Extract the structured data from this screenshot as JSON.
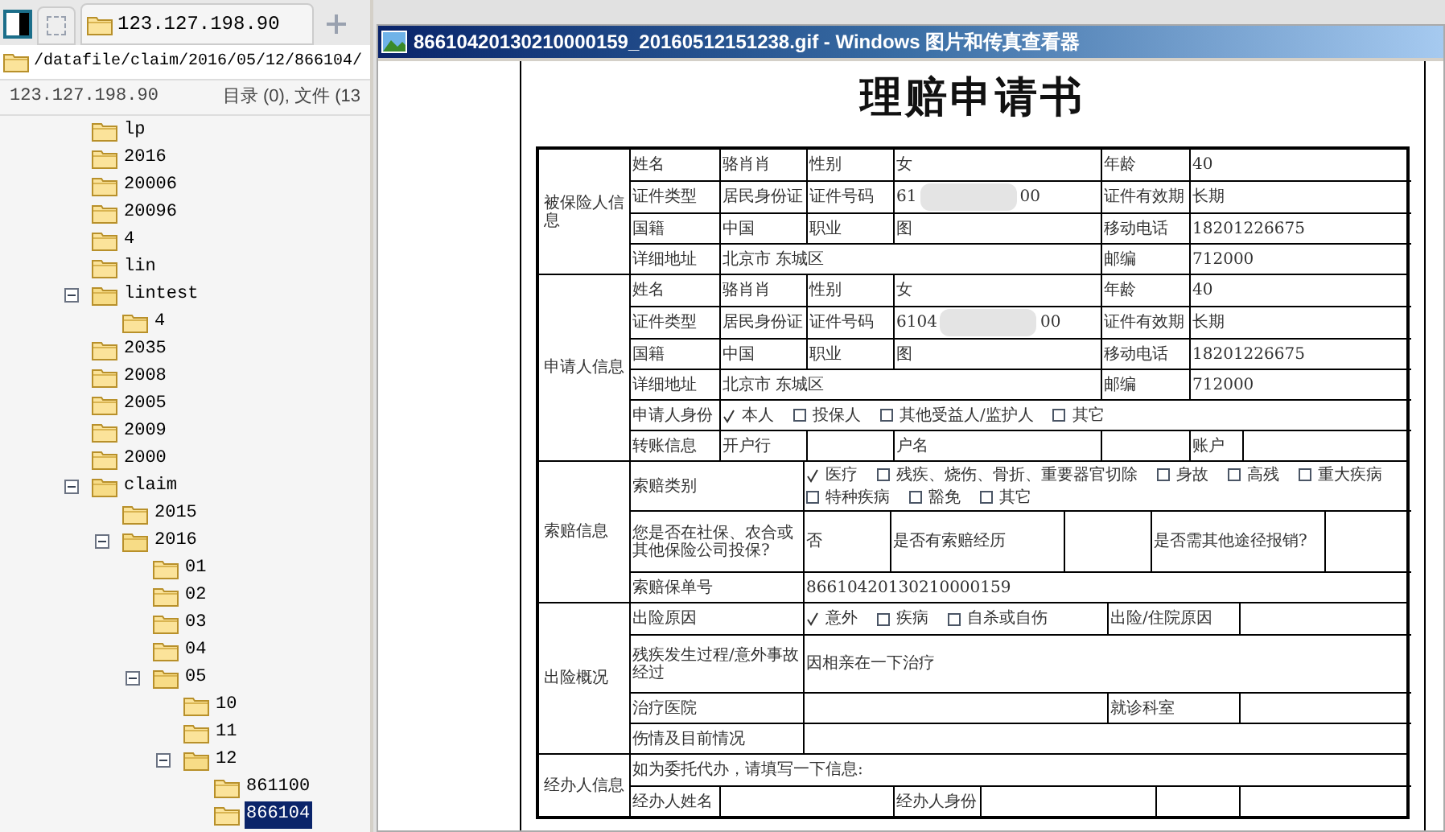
{
  "tabs": [
    {
      "label": "123.127.198.90",
      "selected": true
    }
  ],
  "path": "/datafile/claim/2016/05/12/866104/",
  "status": {
    "host": "123.127.198.90",
    "counts": "目录 (0), 文件 (13"
  },
  "tree": [
    {
      "label": "lp"
    },
    {
      "label": "2016"
    },
    {
      "label": "20006"
    },
    {
      "label": "20096"
    },
    {
      "label": "4"
    },
    {
      "label": "lin"
    },
    {
      "label": "lintest",
      "expanded": true,
      "children": [
        {
          "label": "4"
        }
      ]
    },
    {
      "label": "2035"
    },
    {
      "label": "2008"
    },
    {
      "label": "2005"
    },
    {
      "label": "2009"
    },
    {
      "label": "2000"
    },
    {
      "label": "claim",
      "expanded": true,
      "children": [
        {
          "label": "2015"
        },
        {
          "label": "2016",
          "expanded": true,
          "children": [
            {
              "label": "01"
            },
            {
              "label": "02"
            },
            {
              "label": "03"
            },
            {
              "label": "04"
            },
            {
              "label": "05",
              "expanded": true,
              "children": [
                {
                  "label": "10"
                },
                {
                  "label": "11"
                },
                {
                  "label": "12",
                  "expanded": true,
                  "children": [
                    {
                      "label": "861100",
                      "selected": false
                    },
                    {
                      "label": "866104",
                      "selected": true
                    }
                  ]
                }
              ]
            }
          ]
        }
      ]
    }
  ],
  "viewer": {
    "title": "86610420130210000159_20160512151238.gif - Windows 图片和传真查看器",
    "document": {
      "title": "理赔申请书",
      "sections": [
        {
          "title": "被保险人信息",
          "rows": [
            {
              "kind": "quad",
              "cells": [
                "姓名",
                "骆肖肖",
                "性别",
                "女",
                "年龄",
                "40"
              ]
            },
            {
              "kind": "quad",
              "cells": [
                "证件类型",
                "居民身份证",
                "证件号码",
                {
                  "before": "61",
                  "after": "00"
                },
                "证件有效期",
                "长期"
              ]
            },
            {
              "kind": "quad",
              "cells": [
                "国籍",
                "中国",
                "职业",
                "图",
                "移动电话",
                "18201226675"
              ]
            },
            {
              "kind": "address",
              "cells": [
                "详细地址",
                "北京市 东城区",
                "",
                "",
                "邮编",
                "712000"
              ]
            }
          ]
        },
        {
          "title": "申请人信息",
          "rows": [
            {
              "kind": "quad",
              "cells": [
                "姓名",
                "骆肖肖",
                "性别",
                "女",
                "年龄",
                "40"
              ]
            },
            {
              "kind": "quad",
              "cells": [
                "证件类型",
                "居民身份证",
                "证件号码",
                {
                  "before": "6104",
                  "after": "00"
                },
                "证件有效期",
                "长期"
              ]
            },
            {
              "kind": "quad",
              "cells": [
                "国籍",
                "中国",
                "职业",
                "图",
                "移动电话",
                "18201226675"
              ]
            },
            {
              "kind": "address",
              "cells": [
                "详细地址",
                "北京市 东城区",
                "",
                "",
                "邮编",
                "712000"
              ]
            },
            {
              "kind": "choices",
              "cells": [
                "申请人身份",
                {
                  "options": [
                    {
                      "label": "本人",
                      "checked": true
                    },
                    {
                      "label": "投保人",
                      "checked": false
                    },
                    {
                      "label": "其他受益人/监护人",
                      "checked": false
                    },
                    {
                      "label": "其它",
                      "checked": false
                    }
                  ]
                }
              ]
            },
            {
              "kind": "transfer",
              "cells": [
                "转账信息",
                "开户行",
                "",
                "户名",
                "",
                "账户",
                ""
              ]
            }
          ]
        },
        {
          "title": "索赔信息",
          "rows": [
            {
              "kind": "claim_type",
              "cells": [
                "索赔类别",
                {
                  "options": [
                    {
                      "label": "医疗",
                      "checked": true
                    },
                    {
                      "label": "残疾、烧伤、骨折、重要器官切除",
                      "checked": false
                    },
                    {
                      "label": "身故",
                      "checked": false
                    },
                    {
                      "label": "高残",
                      "checked": false
                    },
                    {
                      "label": "重大疾病",
                      "checked": false
                    },
                    {
                      "label": "特种疾病",
                      "checked": false
                    },
                    {
                      "label": "豁免",
                      "checked": false
                    },
                    {
                      "label": "其它",
                      "checked": false
                    }
                  ]
                }
              ]
            },
            {
              "kind": "yesno",
              "cells": [
                "您是否在社保、农合或其他保险公司投保?",
                "否",
                "是否有索赔经历",
                "",
                "是否需其他途径报销?",
                ""
              ]
            },
            {
              "kind": "wide",
              "cells": [
                "索赔保单号",
                "86610420130210000159"
              ]
            }
          ]
        },
        {
          "title": "出险概况",
          "rows": [
            {
              "kind": "reason",
              "cells": [
                "出险原因",
                {
                  "options": [
                    {
                      "label": "意外",
                      "checked": true
                    },
                    {
                      "label": "疾病",
                      "checked": false
                    },
                    {
                      "label": "自杀或自伤",
                      "checked": false
                    }
                  ]
                },
                "出险/住院原因",
                ""
              ]
            },
            {
              "kind": "tall",
              "cells": [
                "残疾发生过程/意外事故经过",
                "因相亲在一下治疗"
              ]
            },
            {
              "kind": "reason",
              "cells": [
                "治疗医院",
                "",
                "就诊科室",
                ""
              ]
            },
            {
              "kind": "wide",
              "cells": [
                "伤情及目前情况",
                ""
              ]
            }
          ]
        },
        {
          "title": "经办人信息",
          "rows": [
            {
              "kind": "note",
              "cells": [
                "如为委托代办，请填写一下信息:"
              ]
            },
            {
              "kind": "agent",
              "cells": [
                "经办人姓名",
                "",
                "经办人身份",
                "",
                "",
                ""
              ]
            }
          ]
        }
      ]
    }
  }
}
